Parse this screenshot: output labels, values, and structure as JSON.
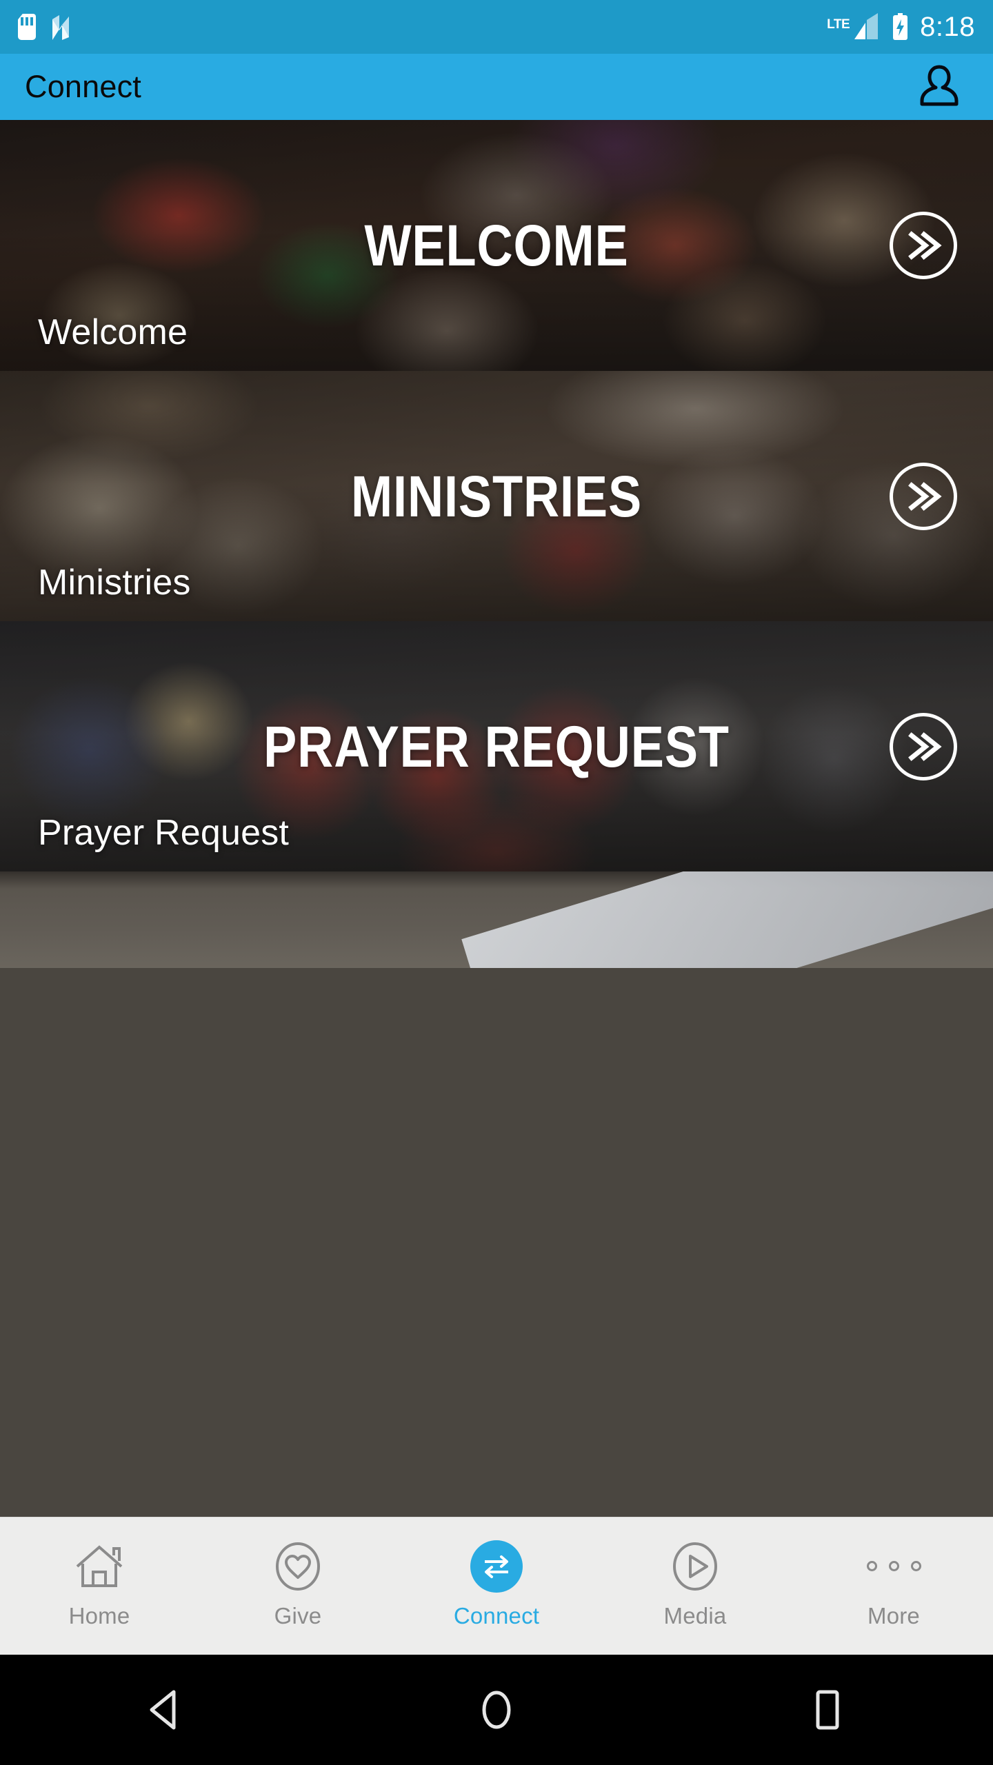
{
  "status_bar": {
    "time": "8:18",
    "network_label": "LTE",
    "icons": [
      "sd-card-icon",
      "android-n-icon",
      "lte-signal-icon",
      "battery-charging-icon"
    ]
  },
  "app_bar": {
    "title": "Connect",
    "account_icon": "person-icon",
    "background_color": "#29ABE2",
    "title_color": "#0A0A0A"
  },
  "cards": [
    {
      "overlay_title": "WELCOME",
      "caption": "Welcome",
      "go_icon": "double-chevron-right-icon",
      "photo": "crowd-standing-in-auditorium"
    },
    {
      "overlay_title": "MINISTRIES",
      "caption": "Ministries",
      "go_icon": "double-chevron-right-icon",
      "photo": "people-seated-at-round-tables"
    },
    {
      "overlay_title": "PRAYER REQUEST",
      "caption": "Prayer Request",
      "go_icon": "double-chevron-right-icon",
      "photo": "families-praying-together"
    },
    {
      "overlay_title": "",
      "caption": "",
      "go_icon": "",
      "photo": "partially-visible-next-card"
    }
  ],
  "tab_bar": {
    "active_color": "#29ABE2",
    "inactive_color": "#8B8B8B",
    "background_color": "#EDEDEC",
    "tabs": [
      {
        "label": "Home",
        "icon": "house-icon",
        "active": false
      },
      {
        "label": "Give",
        "icon": "heart-in-circle-icon",
        "active": false
      },
      {
        "label": "Connect",
        "icon": "two-way-arrows-icon",
        "active": true
      },
      {
        "label": "Media",
        "icon": "play-in-circle-icon",
        "active": false
      },
      {
        "label": "More",
        "icon": "three-dots-icon",
        "active": false
      }
    ]
  },
  "android_nav": {
    "back": "back-triangle-icon",
    "home": "home-circle-icon",
    "recents": "recents-square-icon"
  }
}
